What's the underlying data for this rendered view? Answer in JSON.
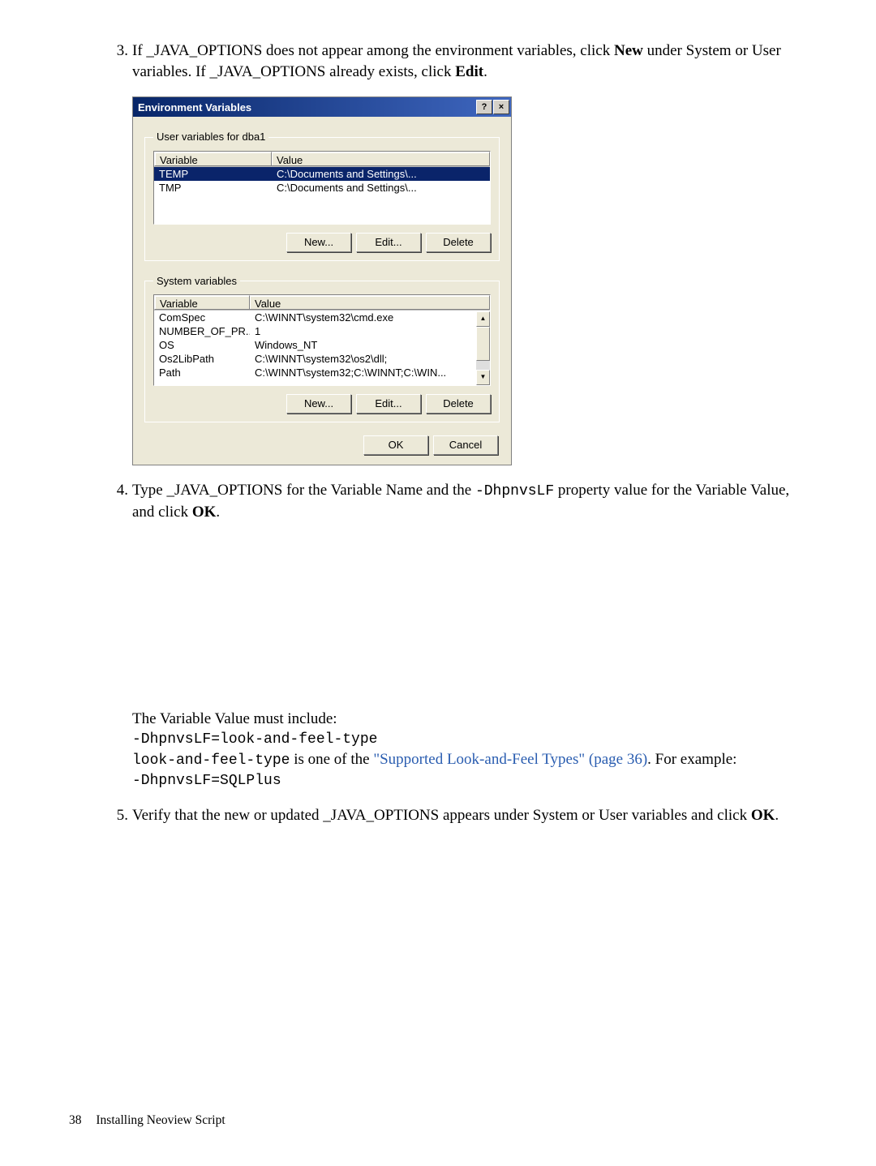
{
  "step3": {
    "num": "3.",
    "text_a": "If _JAVA_OPTIONS does not appear among the environment variables, click ",
    "bold_new": "New",
    "text_b": " under System or User variables. If _JAVA_OPTIONS already exists, click ",
    "bold_edit": "Edit",
    "text_c": "."
  },
  "dialog": {
    "title": "Environment Variables",
    "help_icon": "?",
    "close_icon": "×",
    "user_group_legend": "User variables for dba1",
    "sys_group_legend": "System variables",
    "columns": {
      "variable": "Variable",
      "value": "Value"
    },
    "user_rows": [
      {
        "var": "TEMP",
        "val": "C:\\Documents and Settings\\...",
        "sel": true
      },
      {
        "var": "TMP",
        "val": "C:\\Documents and Settings\\...",
        "sel": false
      }
    ],
    "sys_rows": [
      {
        "var": "ComSpec",
        "val": "C:\\WINNT\\system32\\cmd.exe"
      },
      {
        "var": "NUMBER_OF_PR...",
        "val": "1"
      },
      {
        "var": "OS",
        "val": "Windows_NT"
      },
      {
        "var": "Os2LibPath",
        "val": "C:\\WINNT\\system32\\os2\\dll;"
      },
      {
        "var": "Path",
        "val": "C:\\WINNT\\system32;C:\\WINNT;C:\\WIN..."
      }
    ],
    "btn_new": "New...",
    "btn_edit": "Edit...",
    "btn_delete": "Delete",
    "btn_ok": "OK",
    "btn_cancel": "Cancel"
  },
  "step4": {
    "num": "4.",
    "text_a": "Type _JAVA_OPTIONS for the Variable Name and the ",
    "code_a": "-DhpnvsLF",
    "text_b": " property value for the Variable Value, and click ",
    "bold_ok": "OK",
    "text_c": "."
  },
  "mid_para": {
    "line1": "The Variable Value must include:",
    "code1": "-DhpnvsLF=look-and-feel-type",
    "line3a": "",
    "code_lft": "look-and-feel-type",
    "line3b": " is one of the ",
    "link_text": "\"Supported Look-and-Feel Types\" (page 36)",
    "line3c": ". For example:",
    "code2": "-DhpnvsLF=SQLPlus"
  },
  "step5": {
    "num": "5.",
    "text_a": "Verify that the new or updated _JAVA_OPTIONS appears under System or User variables and click ",
    "bold_ok": "OK",
    "text_b": "."
  },
  "footer": {
    "page": "38",
    "section": "Installing Neoview Script"
  }
}
